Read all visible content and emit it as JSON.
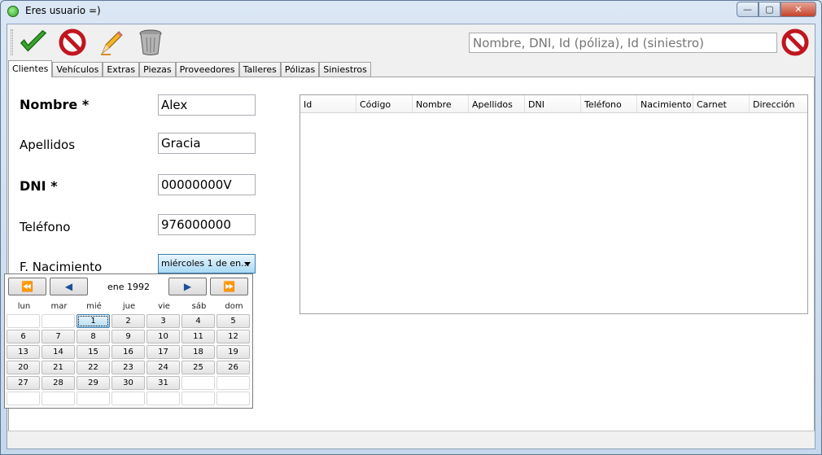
{
  "window": {
    "title": "Eres usuario =)",
    "minimize_glyph": "—",
    "maximize_glyph": "▢",
    "close_glyph": "✕"
  },
  "toolbar": {
    "icons": [
      "confirm-check-icon",
      "cancel-icon",
      "edit-pencil-icon",
      "delete-trash-icon"
    ],
    "search_placeholder": "Nombre, DNI, Id (póliza), Id (siniestro)"
  },
  "tabs": [
    "Clientes",
    "Vehículos",
    "Extras",
    "Piezas",
    "Proveedores",
    "Talleres",
    "Pólizas",
    "Siniestros"
  ],
  "form": {
    "nombre_label": "Nombre *",
    "nombre_value": "Alex",
    "apellidos_label": "Apellidos",
    "apellidos_value": "Gracia",
    "dni_label": "DNI *",
    "dni_value": "00000000V",
    "telefono_label": "Teléfono",
    "telefono_value": "976000000",
    "nacimiento_label": "F. Nacimiento",
    "nacimiento_value": "miércoles 1 de en..."
  },
  "table": {
    "columns": [
      "Id",
      "Código",
      "Nombre",
      "Apellidos",
      "DNI",
      "Teléfono",
      "Nacimiento",
      "Carnet",
      "Dirección"
    ]
  },
  "calendar": {
    "month_label": "ene 1992",
    "weekdays": [
      "lun",
      "mar",
      "mié",
      "jue",
      "vie",
      "sáb",
      "dom"
    ],
    "rows": [
      [
        "",
        "",
        "1",
        "2",
        "3",
        "4",
        "5"
      ],
      [
        "6",
        "7",
        "8",
        "9",
        "10",
        "11",
        "12"
      ],
      [
        "13",
        "14",
        "15",
        "16",
        "17",
        "18",
        "19"
      ],
      [
        "20",
        "21",
        "22",
        "23",
        "24",
        "25",
        "26"
      ],
      [
        "27",
        "28",
        "29",
        "30",
        "31",
        "",
        ""
      ],
      [
        "",
        "",
        "",
        "",
        "",
        "",
        ""
      ]
    ],
    "selected_day": "1",
    "nav": {
      "prev_year": "⏪",
      "prev_month": "◀",
      "next_month": "▶",
      "next_year": "⏩"
    }
  },
  "colors": {
    "accent_blue": "#3c7fb1",
    "confirm_green": "#2f9e28",
    "cancel_red": "#d0202a"
  }
}
